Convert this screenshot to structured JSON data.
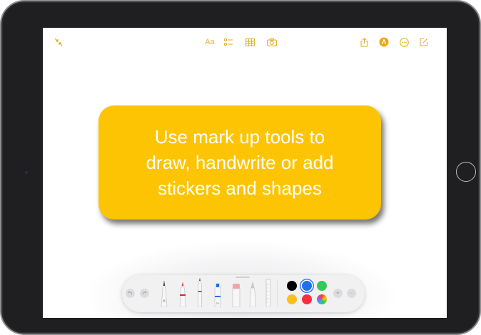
{
  "app": "Notes",
  "toolbar": {
    "collapse_icon": "collapse-arrows-icon",
    "format_label": "Aa",
    "checklist_icon": "checklist-icon",
    "table_icon": "table-icon",
    "camera_icon": "camera-icon",
    "share_icon": "share-icon",
    "markup_icon": "markup-pen-icon",
    "more_icon": "more-ellipsis-icon",
    "compose_icon": "compose-icon"
  },
  "callout": {
    "line1": "Use mark up tools to",
    "line2": "draw, handwrite or add",
    "line3": "stickers and shapes"
  },
  "markup_palette": {
    "undo_icon": "undo-icon",
    "redo_icon": "redo-icon",
    "tools": [
      "pen",
      "marker",
      "pencil",
      "highlighter",
      "eraser",
      "lasso",
      "ruler"
    ],
    "colors": [
      {
        "name": "black",
        "hex": "#000000",
        "selected": false
      },
      {
        "name": "blue",
        "hex": "#1f6ff0",
        "selected": true
      },
      {
        "name": "green",
        "hex": "#34c759",
        "selected": false
      },
      {
        "name": "yellow",
        "hex": "#fdc01a",
        "selected": false
      },
      {
        "name": "red",
        "hex": "#fe2d3e",
        "selected": false
      },
      {
        "name": "color-picker",
        "hex": "multicolor",
        "selected": false
      }
    ],
    "add_label": "+",
    "more_label": "···"
  },
  "accent_color": "#e1a915",
  "callout_color": "#fdc403"
}
